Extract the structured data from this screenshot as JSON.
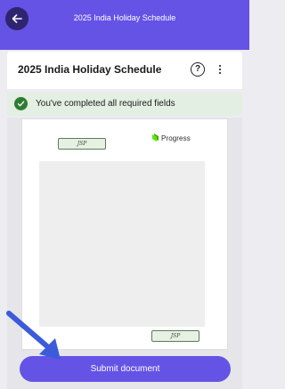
{
  "app_header": {
    "title": "2025 India Holiday Schedule",
    "back_icon": "arrow-left-icon"
  },
  "doc_card": {
    "title": "2025 India Holiday Schedule",
    "help_label": "?",
    "help_icon": "help-circle-icon",
    "more_icon": "more-vertical-icon"
  },
  "status_banner": {
    "text": "You've completed all required fields",
    "icon": "check-circle-icon",
    "color": "#2e7d32"
  },
  "document_preview": {
    "initials_top": "JSP",
    "initials_bottom": "JSP",
    "logo_text": "Progress",
    "logo_color": "#5ce500"
  },
  "footer": {
    "submit_label": "Submit document"
  },
  "colors": {
    "brand_primary": "#6553e6",
    "arrow_annotation": "#3b5bd9"
  }
}
